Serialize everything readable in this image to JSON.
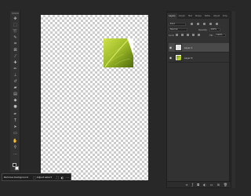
{
  "panel": {
    "tabs": [
      "Layers",
      "Adjust",
      "Hist",
      "Shape",
      "Paths",
      "Adjust",
      "Prop"
    ],
    "search_value": "Kind",
    "blend_mode": "Normal",
    "opacity_label": "Opacity:",
    "opacity_value": "100%",
    "lock_label": "Lock:",
    "fill_label": "Fill:",
    "fill_value": "100%",
    "layers": [
      {
        "name": "Layer 1",
        "visible": true,
        "selected": true
      },
      {
        "name": "Layer 0",
        "visible": true,
        "selected": false
      }
    ],
    "bottom_icons": [
      "link-icon",
      "fx-icon",
      "mask-icon",
      "adjustment-icon",
      "folder-icon",
      "new-layer-icon",
      "trash-icon"
    ]
  },
  "taskbar": {
    "remove_background_label": "Remove background",
    "select_subject_label": "Adjust select"
  },
  "toolbar": {
    "tools": [
      "move-tool",
      "marquee-tool",
      "lasso-tool",
      "quick-select-tool",
      "crop-tool",
      "frame-tool",
      "eyedropper-tool",
      "healing-tool",
      "brush-tool",
      "stamp-tool",
      "history-brush-tool",
      "eraser-tool",
      "gradient-tool",
      "blur-tool",
      "dodge-tool",
      "pen-tool",
      "type-tool",
      "path-select-tool",
      "rectangle-tool",
      "hand-tool",
      "zoom-tool",
      "more-tools"
    ]
  },
  "colors": {
    "app_background": "#282828",
    "panel_background": "#323232",
    "leaf_green": "#9ab827"
  }
}
